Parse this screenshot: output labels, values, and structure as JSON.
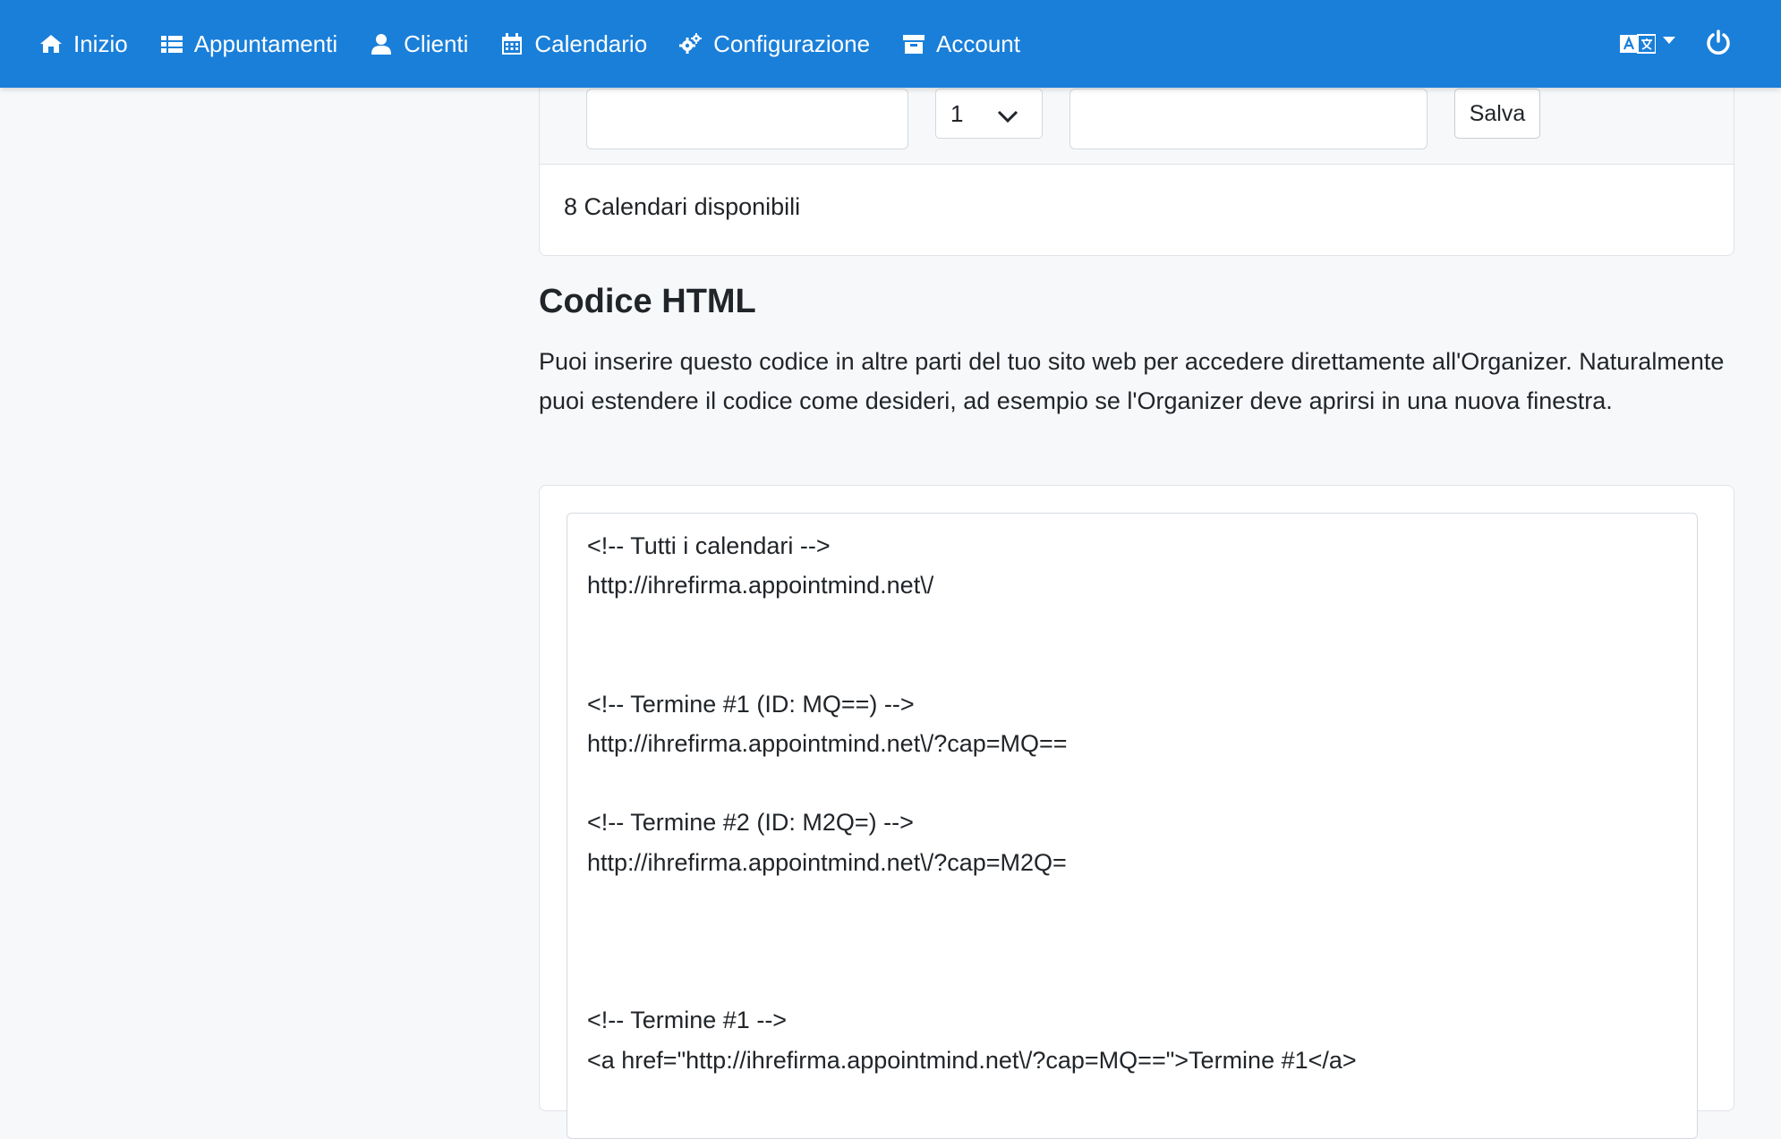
{
  "nav": {
    "items": [
      {
        "label": "Inizio",
        "icon": "home-icon"
      },
      {
        "label": "Appuntamenti",
        "icon": "list-icon"
      },
      {
        "label": "Clienti",
        "icon": "user-icon"
      },
      {
        "label": "Calendario",
        "icon": "calendar-icon"
      },
      {
        "label": "Configurazione",
        "icon": "cogs-icon"
      },
      {
        "label": "Account",
        "icon": "archive-icon"
      }
    ],
    "right": {
      "language_icon": "language-icon",
      "logout_icon": "power-icon"
    }
  },
  "form": {
    "select_value": "1",
    "save_label": "Salva"
  },
  "calendars_available": "8 Calendari disponibili",
  "section": {
    "title": "Codice HTML",
    "description": "Puoi inserire questo codice in altre parti del tuo sito web per accedere direttamente all'Organizer. Naturalmente puoi estendere il codice come desideri, ad esempio se l'Organizer deve aprirsi in una nuova finestra."
  },
  "code": {
    "text": "<!-- Tutti i calendari -->\nhttp://ihrefirma.appointmind.net\\/\n\n\n<!-- Termine #1 (ID: MQ==) -->\nhttp://ihrefirma.appointmind.net\\/?cap=MQ==\n\n<!-- Termine #2 (ID: M2Q=) -->\nhttp://ihrefirma.appointmind.net\\/?cap=M2Q=\n\n\n\n<!-- Termine #1 -->\n<a href=\"http://ihrefirma.appointmind.net\\/?cap=MQ==\">Termine #1</a>"
  },
  "colors": {
    "navbar": "#1a7fd9",
    "background": "#f7f8fa"
  }
}
